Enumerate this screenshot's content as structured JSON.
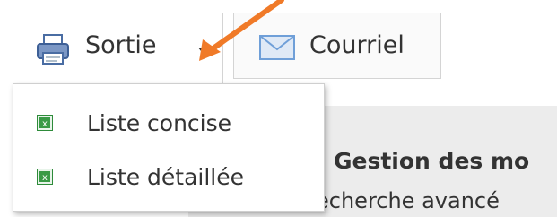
{
  "toolbar": {
    "sortie_label": "Sortie",
    "courriel_label": "Courriel"
  },
  "dropdown": {
    "items": [
      {
        "label": "Liste concise",
        "icon": "excel-icon"
      },
      {
        "label": "Liste détaillée",
        "icon": "excel-icon"
      }
    ]
  },
  "background": {
    "title": "Gestion des mo",
    "subtitle": "echerche avancé"
  },
  "colors": {
    "annotation_arrow": "#f07a28",
    "excel_green": "#2e8b3a",
    "mail_blue": "#6f9fd8"
  }
}
